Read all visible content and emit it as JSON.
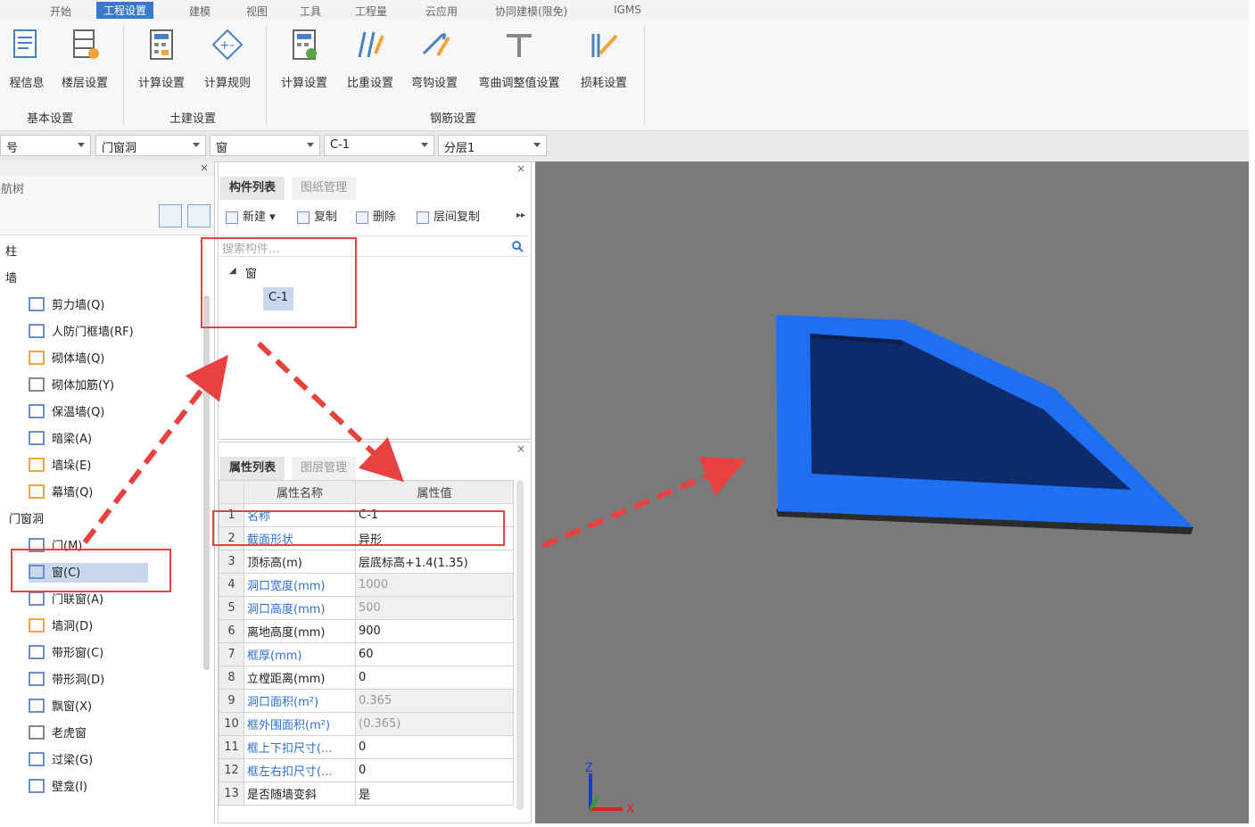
{
  "menu": [
    "开始",
    "工程设置",
    "建模",
    "视图",
    "工具",
    "工程量",
    "云应用",
    "协同建模(限免)",
    "IGMS"
  ],
  "ribbon": {
    "basic": {
      "group": "基本设置",
      "buttons": [
        "程信息",
        "楼层设置"
      ]
    },
    "civil": {
      "group": "土建设置",
      "buttons": [
        "计算设置",
        "计算规则"
      ]
    },
    "rebar": {
      "group": "钢筋设置",
      "buttons": [
        "计算设置",
        "比重设置",
        "弯钩设置",
        "弯曲调整值设置",
        "损耗设置"
      ]
    }
  },
  "selectors": [
    "号",
    "门窗洞",
    "窗",
    "C-1",
    "分层1"
  ],
  "nav": {
    "title": "导航树",
    "categories": [
      "柱",
      "墙",
      "门窗洞"
    ],
    "items": [
      "剪力墙(Q)",
      "人防门框墙(RF)",
      "砌体墙(Q)",
      "砌体加筋(Y)",
      "保温墙(Q)",
      "暗梁(A)",
      "墙垛(E)",
      "幕墙(Q)",
      "门(M)",
      "窗(C)",
      "门联窗(A)",
      "墙洞(D)",
      "带形窗(C)",
      "带形洞(D)",
      "飘窗(X)",
      "老虎窗",
      "过梁(G)",
      "壁龛(I)"
    ]
  },
  "component_list": {
    "tabs": [
      "构件列表",
      "图纸管理"
    ],
    "toolbar": [
      "新建",
      "复制",
      "删除",
      "层间复制"
    ],
    "search_placeholder": "搜索构件...",
    "tree": {
      "group": "窗",
      "item": "C-1"
    }
  },
  "property_list": {
    "tabs": [
      "属性列表",
      "图层管理"
    ],
    "headers": [
      "属性名称",
      "属性值"
    ],
    "rows": [
      {
        "n": "1",
        "name": "名称",
        "value": "C-1"
      },
      {
        "n": "2",
        "name": "截面形状",
        "value": "异形"
      },
      {
        "n": "3",
        "name": "顶标高(m)",
        "value": "层底标高+1.4(1.35)"
      },
      {
        "n": "4",
        "name": "洞口宽度(mm)",
        "value": "1000"
      },
      {
        "n": "5",
        "name": "洞口高度(mm)",
        "value": "500"
      },
      {
        "n": "6",
        "name": "离地高度(mm)",
        "value": "900"
      },
      {
        "n": "7",
        "name": "框厚(mm)",
        "value": "60"
      },
      {
        "n": "8",
        "name": "立樘距离(mm)",
        "value": "0"
      },
      {
        "n": "9",
        "name": "洞口面积(m²)",
        "value": "0.365"
      },
      {
        "n": "10",
        "name": "框外围面积(m²)",
        "value": "(0.365)"
      },
      {
        "n": "11",
        "name": "框上下扣尺寸(...",
        "value": "0"
      },
      {
        "n": "12",
        "name": "框左右扣尺寸(...",
        "value": "0"
      },
      {
        "n": "13",
        "name": "是否随墙变斜",
        "value": "是"
      }
    ]
  },
  "axis": {
    "z": "Z",
    "x": "X"
  },
  "colors": {
    "accent": "#3a78c9",
    "annotation": "#e8413f",
    "frame": "#1f6ff2",
    "glass": "#0d2a6b",
    "viewport": "#7a7a7a",
    "blue_text": "#2f6fd1"
  }
}
